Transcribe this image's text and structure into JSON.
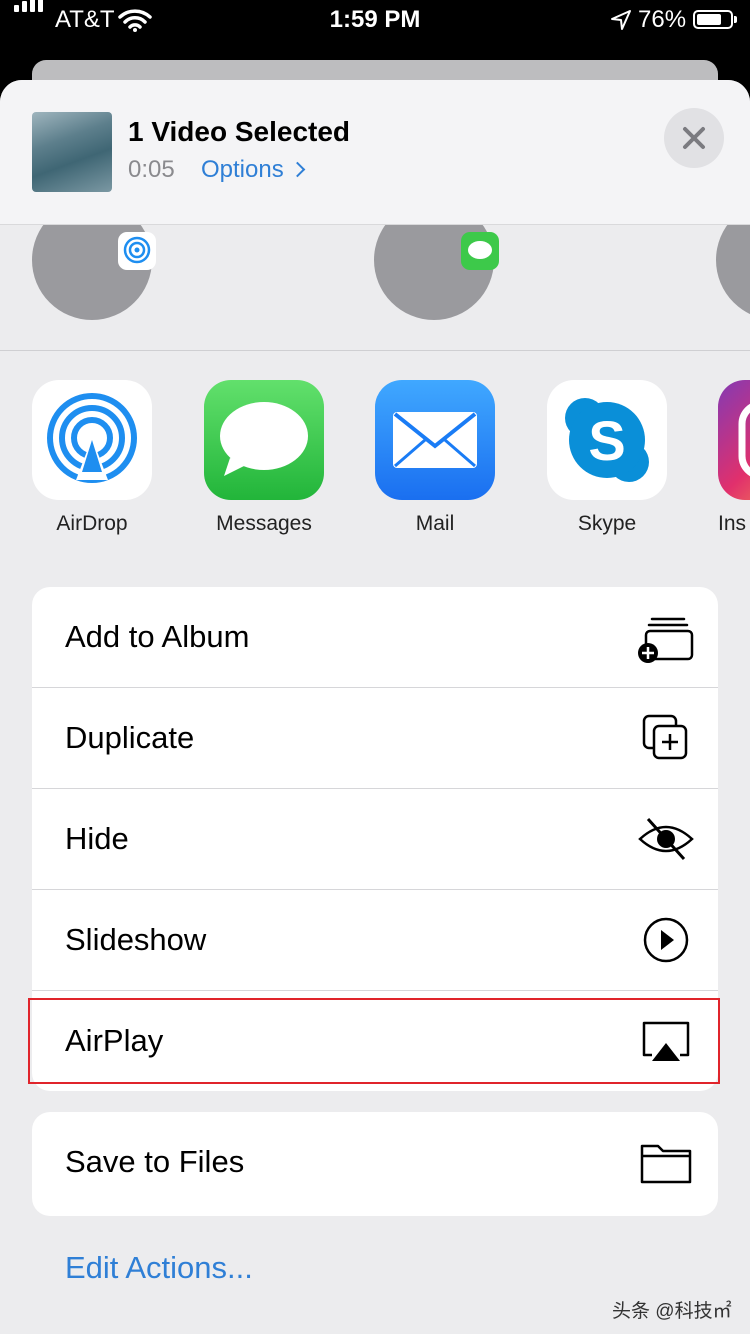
{
  "status_bar": {
    "carrier": "AT&T",
    "time": "1:59 PM",
    "battery_pct": "76%",
    "battery_level": 0.76,
    "icons": [
      "signal-icon",
      "wifi-icon",
      "location-icon",
      "battery-icon"
    ]
  },
  "header": {
    "title": "1 Video Selected",
    "duration": "0:05",
    "options_label": "Options",
    "close_icon": "close-icon"
  },
  "apps": [
    {
      "label": "AirDrop",
      "icon": "airdrop-icon"
    },
    {
      "label": "Messages",
      "icon": "messages-icon"
    },
    {
      "label": "Mail",
      "icon": "mail-icon"
    },
    {
      "label": "Skype",
      "icon": "skype-icon"
    },
    {
      "label": "Ins",
      "icon": "instagram-icon"
    }
  ],
  "actions": [
    {
      "label": "Add to Album",
      "icon": "add-to-album-icon"
    },
    {
      "label": "Duplicate",
      "icon": "duplicate-icon"
    },
    {
      "label": "Hide",
      "icon": "hide-eye-icon"
    },
    {
      "label": "Slideshow",
      "icon": "play-icon"
    },
    {
      "label": "AirPlay",
      "icon": "airplay-icon",
      "highlighted": true
    }
  ],
  "actions2": [
    {
      "label": "Save to Files",
      "icon": "folder-icon"
    }
  ],
  "edit_actions_label": "Edit Actions...",
  "watermark": "头条 @科技㎡",
  "colors": {
    "link": "#2f7fd6",
    "highlight": "#e0242b"
  }
}
